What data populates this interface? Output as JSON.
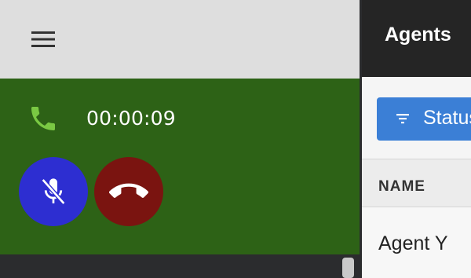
{
  "call": {
    "timer": "00:00:09",
    "mute_state": "muted"
  },
  "icons": {
    "menu": "hamburger-menu-icon",
    "phone": "phone-icon",
    "mute": "mic-off-icon",
    "hangup": "hangup-icon",
    "filter": "filter-icon"
  },
  "colors": {
    "call_panel": "#2d6216",
    "phone_icon": "#7ac943",
    "mute_button": "#2d2ed1",
    "hangup_button": "#7a1410",
    "status_button": "#3b7fd6",
    "agents_header": "#252525"
  },
  "agents": {
    "title": "Agents",
    "status_button_label": "Status",
    "columns": [
      "NAME"
    ],
    "rows": [
      {
        "name": "Agent Y"
      }
    ]
  }
}
